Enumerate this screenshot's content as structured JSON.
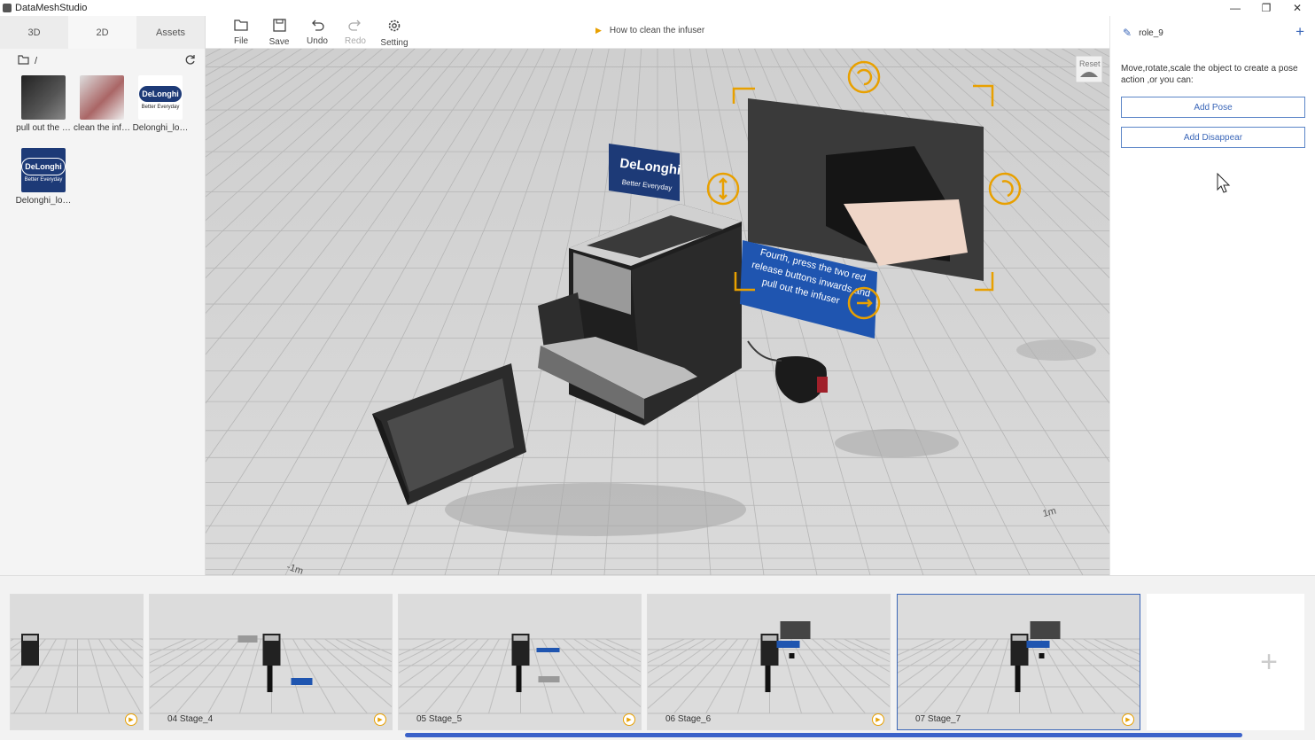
{
  "window": {
    "title": "DataMeshStudio",
    "controls": [
      "—",
      "❐",
      "✕"
    ]
  },
  "left_panel": {
    "tabs": [
      {
        "label": "3D"
      },
      {
        "label": "2D"
      },
      {
        "label": "Assets"
      }
    ],
    "path": "/",
    "assets": [
      {
        "label": "pull out the …",
        "thumb": "dark"
      },
      {
        "label": "clean the inf…",
        "thumb": "light"
      },
      {
        "label": "Delonghi_lo…",
        "thumb": "logo",
        "logo_text": "DeLonghi",
        "logo_sub": "Better Everyday"
      },
      {
        "label": "Delonghi_lo…",
        "thumb": "logo2",
        "logo_text": "DeLonghi",
        "logo_sub": "Better Everyday"
      }
    ]
  },
  "toolbar": {
    "tools": [
      {
        "label": "File",
        "icon": "folder-icon"
      },
      {
        "label": "Save",
        "icon": "save-icon"
      },
      {
        "label": "Undo",
        "icon": "undo-icon"
      },
      {
        "label": "Redo",
        "icon": "redo-icon"
      },
      {
        "label": "Setting",
        "icon": "gear-icon"
      }
    ],
    "stage_title": "How to clean the infuser"
  },
  "viewport": {
    "reset_label": "Reset",
    "sign_text": [
      "Fourth, press the two red",
      "release buttons inwards and",
      "pull out the infuser"
    ],
    "logo_text": "DeLonghi",
    "logo_sub": "Better Everyday",
    "axis_labels": {
      "x": "1m",
      "z": "-1m"
    }
  },
  "right_panel": {
    "role_name": "role_9",
    "hint": "Move,rotate,scale the object to create a pose action ,or you can:",
    "add_pose_label": "Add Pose",
    "add_disappear_label": "Add Disappear"
  },
  "timeline": {
    "stages": [
      {
        "label": ""
      },
      {
        "label": "04  Stage_4"
      },
      {
        "label": "05  Stage_5"
      },
      {
        "label": "06  Stage_6"
      },
      {
        "label": "07  Stage_7",
        "selected": true
      }
    ],
    "add_label": "+"
  },
  "colors": {
    "accent": "#3a66b8",
    "gizmo": "#e8a000",
    "scrollbar": "#3b62c9",
    "sign": "#1f55b0"
  }
}
